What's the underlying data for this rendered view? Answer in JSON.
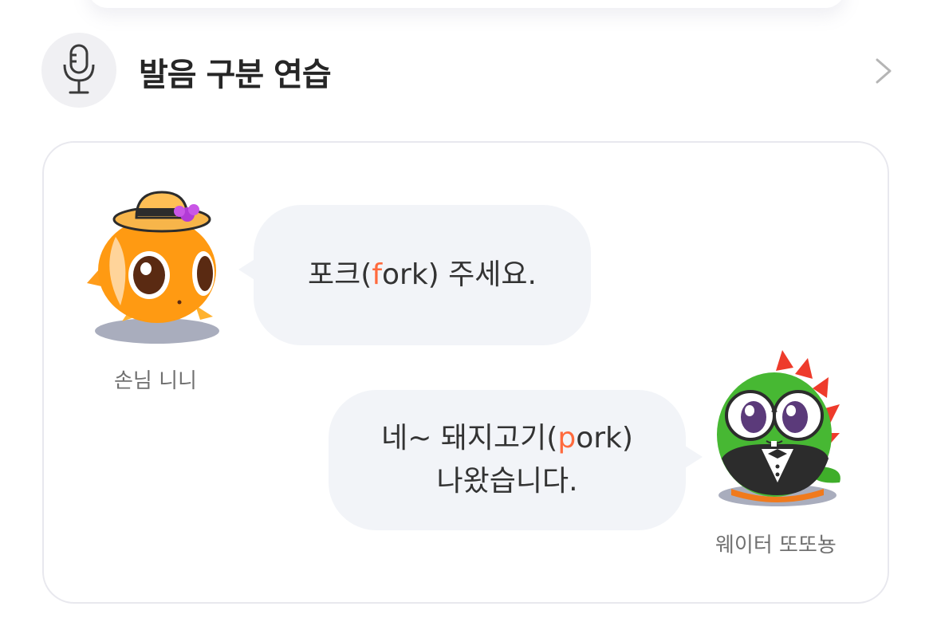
{
  "section": {
    "title": "발음 구분 연습",
    "icon": "microphone-icon",
    "more_icon": "chevron-right-icon"
  },
  "dialogue": {
    "customer": {
      "name": "손님 니니",
      "avatar": "orange-fish-with-hat",
      "bubble": {
        "before": "포크(",
        "highlight": "f",
        "after": "ork) 주세요."
      }
    },
    "waiter": {
      "name": "웨이터 또또뇽",
      "avatar": "green-dinosaur-with-glasses",
      "bubble": {
        "line1_before": "네~ 돼지고기(",
        "line1_highlight": "p",
        "line1_after": "ork)",
        "line2": "나왔습니다."
      }
    }
  },
  "colors": {
    "highlight": "#ff6a3d",
    "bubble_bg": "#f2f4f8",
    "title": "#262626"
  }
}
